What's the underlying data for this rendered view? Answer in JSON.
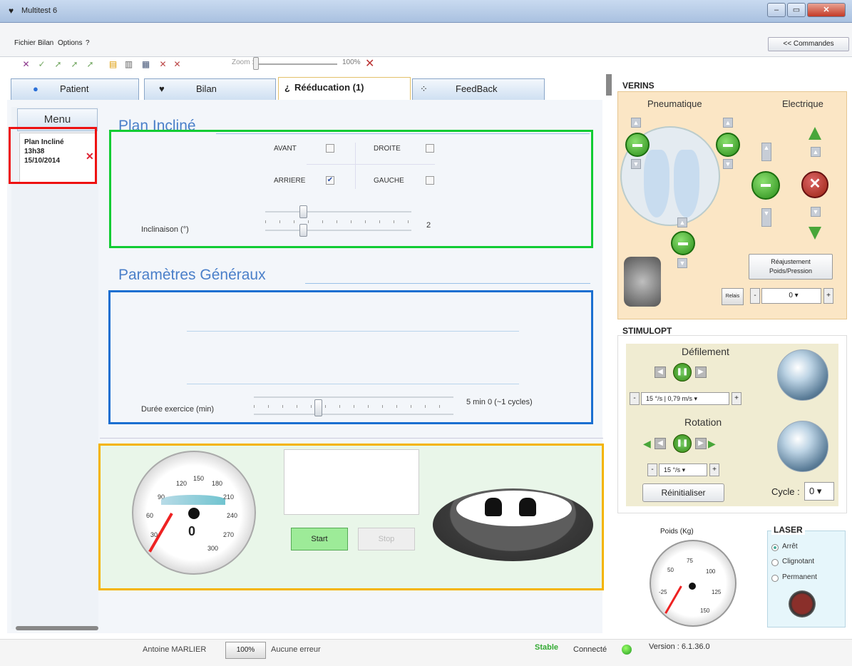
{
  "window": {
    "title": "Multitest 6",
    "min": "–",
    "max": "▭",
    "close": "✕"
  },
  "menu": [
    "Fichier",
    "Bilan",
    "Options",
    "?"
  ],
  "commands_button": "<< Commandes",
  "toolbar": {
    "zoom_label": "Zoom :",
    "zoom_value": "100%"
  },
  "tabs": [
    {
      "label": "Patient",
      "icon": "person-icon"
    },
    {
      "label": "Bilan",
      "icon": "feet-icon"
    },
    {
      "label": "Rééducation (1)",
      "icon": "rehab-icon"
    },
    {
      "label": "FeedBack",
      "icon": "feedback-icon"
    }
  ],
  "sidebar": {
    "menu_label": "Menu",
    "session": {
      "line1": "Plan Incliné",
      "line2": "13h38",
      "line3": "15/10/2014"
    }
  },
  "plan_incline": {
    "title": "Plan Incliné",
    "avant": "AVANT",
    "droite": "DROITE",
    "arriere": "ARRIERE",
    "gauche": "GAUCHE",
    "arriere_checked": true,
    "inclinaison_label": "Inclinaison (°)",
    "inclinaison_value": "2"
  },
  "parametres": {
    "title": "Paramètres Généraux",
    "duree_label": "Durée exercice (min)",
    "duree_value": "5 min 0 (~1 cycles)"
  },
  "controls": {
    "start": "Start",
    "stop": "Stop"
  },
  "speed_gauge": {
    "ticks": [
      "30",
      "60",
      "90",
      "120",
      "150",
      "180",
      "210",
      "240",
      "270",
      "300"
    ],
    "value": "0"
  },
  "verins": {
    "title": "VERINS",
    "pneumatique": "Pneumatique",
    "electrique": "Electrique",
    "reajustement": "Réajustement Poids/Pression",
    "relais": "Relais",
    "minus": "-",
    "plus": "+",
    "value": "0"
  },
  "stimulopt": {
    "title": "STIMULOPT",
    "defilement": "Défilement",
    "defil_value": "15 °/s | 0,79 m/s",
    "rotation": "Rotation",
    "rot_value": "15 °/s",
    "reinit": "Réinitialiser",
    "cycle_label": "Cycle :",
    "cycle_value": "0"
  },
  "poids": {
    "label": "Poids (Kg)",
    "ticks": [
      "-25",
      "50",
      "75",
      "100",
      "125",
      "150"
    ]
  },
  "laser": {
    "title": "LASER",
    "options": [
      "Arrêt",
      "Clignotant",
      "Permanent"
    ],
    "selected": 0
  },
  "status": {
    "user": "Antoine MARLIER",
    "zoom": "100%",
    "errors": "Aucune erreur",
    "stable": "Stable",
    "connected": "Connecté",
    "version": "Version : 6.1.36.0"
  }
}
